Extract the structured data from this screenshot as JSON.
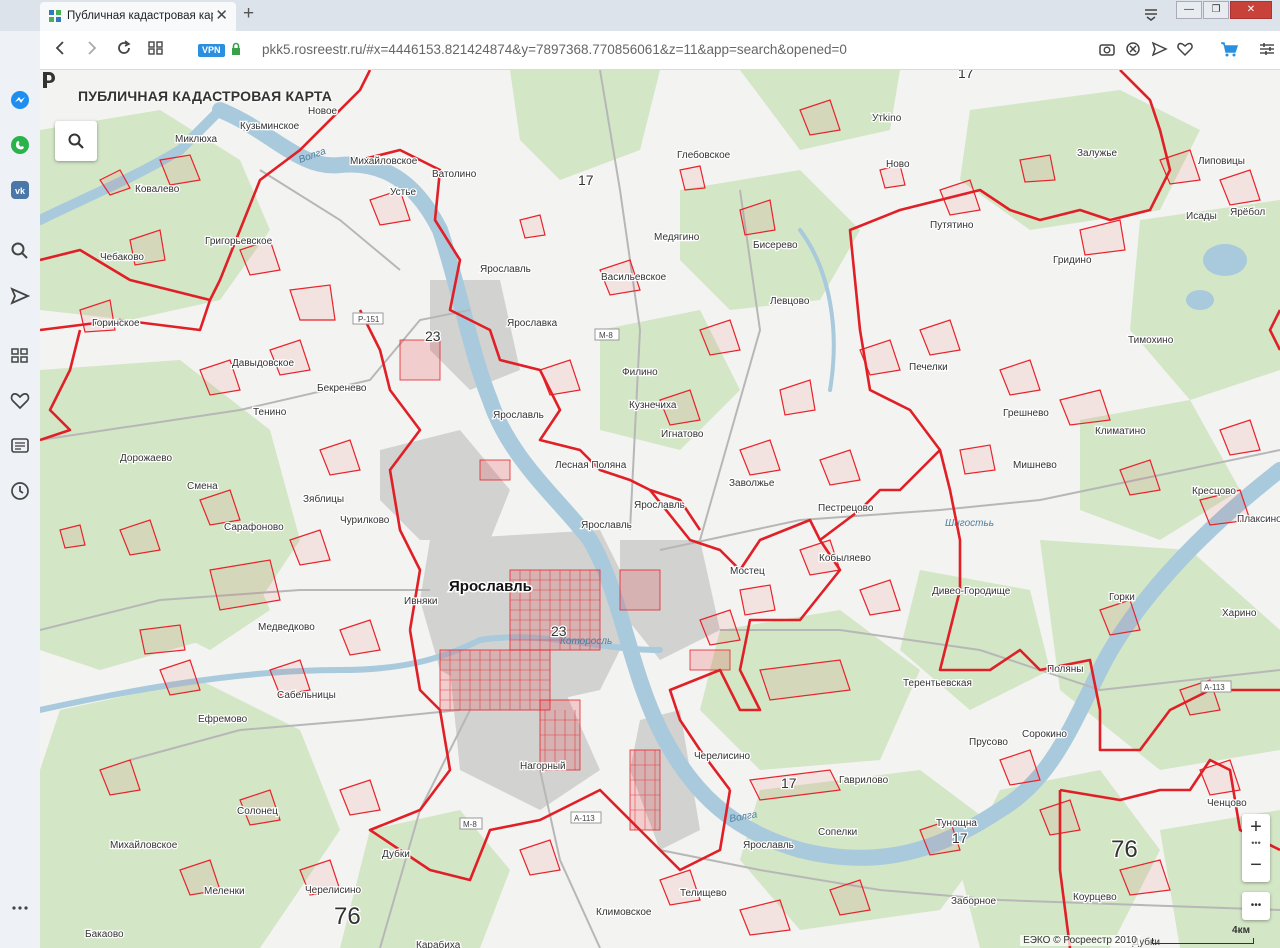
{
  "browser": {
    "tab_title": "Публичная кадастровая карт",
    "new_tab": "+",
    "close_tab": "✕",
    "vpn_badge": "VPN",
    "url": "pkk5.rosreestr.ru/#x=4446153.821424874&y=7897368.770856061&z=11&app=search&opened=0",
    "window_controls": [
      "—",
      "❐",
      "✕"
    ]
  },
  "sidebar": {
    "icons": [
      "opera-logo-icon",
      "messenger-icon",
      "whatsapp-icon",
      "vk-icon",
      "search-icon",
      "send-icon",
      "speed-dial-icon",
      "heart-icon",
      "news-icon",
      "history-icon",
      "more-icon"
    ]
  },
  "map": {
    "app_title": "ПУБЛИЧНАЯ КАДАСТРОВАЯ КАРТА",
    "zoom_in": "+",
    "zoom_out": "−",
    "more": "•••",
    "attribution": "ЕЭКО © Росреестр 2010",
    "scale_label": "4км",
    "cut_label": "Дубки",
    "region_labels": [
      "17",
      "23",
      "76"
    ],
    "labels": {
      "city": "Ярославль",
      "places": [
        "Новое",
        "Кузьминское",
        "Михайловское",
        "Миклюха",
        "Ватолино",
        "Устье",
        "Ковалево",
        "Чебаково",
        "Григорьевское",
        "Горинское",
        "Давыдовское",
        "Бекренево",
        "Тенино",
        "Дорожаево",
        "Смена",
        "Зяблицы",
        "Сарафоново",
        "Чурилково",
        "Ивняки",
        "Медведково",
        "Сабельницы",
        "Ефремово",
        "Солонец",
        "Михайловское",
        "Меленки",
        "Бакаово",
        "Черелисино",
        "Дубки",
        "Нагорный",
        "Ярославль",
        "Ярославка",
        "Филино",
        "Кузнечиха",
        "Игнатово",
        "Лесная Поляна",
        "Заволжье",
        "Мостец",
        "Кобыляево",
        "Пестрецово",
        "Дивео-Городище",
        "Терентьевская",
        "Прусово",
        "Поляны",
        "Сорокино",
        "Горки",
        "Харино",
        "Кресцово",
        "Плаксино",
        "Климатино",
        "Мишнево",
        "Грешнево",
        "Печелки",
        "Тимохино",
        "Гридино",
        "Путятино",
        "Исады",
        "Ярёбол",
        "Липовицы",
        "Залужье",
        "Утkino",
        "Глебовское",
        "Медягино",
        "Бисерево",
        "Васильевское",
        "Левцово",
        "Ново",
        "Телищево",
        "Климовское",
        "Ярославль",
        "Гаврилово",
        "Сопелки",
        "Тунощна",
        "Заборное",
        "Коурцево",
        "Ченцово",
        "Карабиха"
      ],
      "roads": [
        "Р-151",
        "М-8",
        "М-8",
        "А-113",
        "А-113",
        "А-113"
      ],
      "rivers": [
        "Волга",
        "Волга",
        "Которосль",
        "Шигостьь"
      ]
    }
  },
  "colors": {
    "cadastre_red": "#e8232b",
    "forest_green": "#d3e6c6",
    "water_blue": "#a9c9dc",
    "urban_gray": "#c9c9c9"
  }
}
